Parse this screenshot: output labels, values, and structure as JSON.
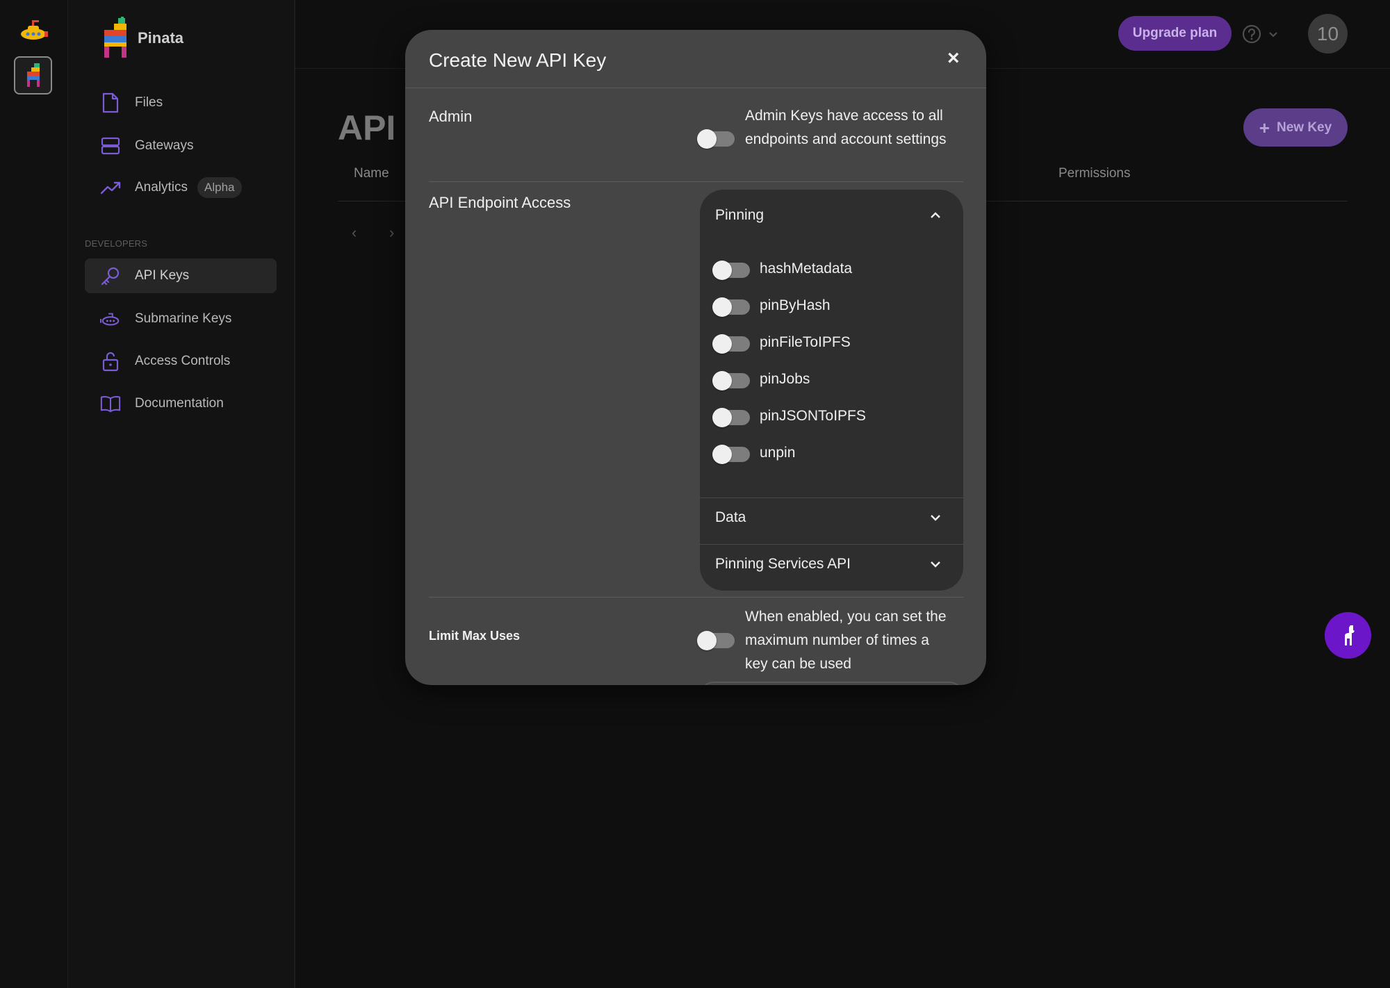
{
  "app": {
    "brand": "Pinata"
  },
  "sidebar": {
    "items": [
      {
        "label": "Files",
        "icon": "file-icon"
      },
      {
        "label": "Gateways",
        "icon": "server-icon"
      },
      {
        "label": "Analytics",
        "icon": "trend-icon",
        "badge": "Alpha"
      },
      {
        "label": "API Keys",
        "icon": "key-icon",
        "active": true
      },
      {
        "label": "Submarine Keys",
        "icon": "submarine-icon"
      },
      {
        "label": "Access Controls",
        "icon": "lock-icon"
      },
      {
        "label": "Documentation",
        "icon": "book-icon"
      }
    ],
    "section_developers": "DEVELOPERS"
  },
  "topbar": {
    "upgrade_label": "Upgrade plan",
    "avatar_text": "10"
  },
  "page": {
    "title": "API",
    "new_key_label": "New Key",
    "columns": [
      "Name",
      "Permissions"
    ],
    "pager_prev": "‹",
    "pager_next": "›"
  },
  "modal": {
    "title": "Create New API Key",
    "close": "×",
    "admin": {
      "label": "Admin",
      "description": "Admin Keys have access to all endpoints and account settings",
      "enabled": false
    },
    "endpoint_access": {
      "label": "API Endpoint Access",
      "groups": [
        {
          "name": "Pinning",
          "expanded": true,
          "endpoints": [
            {
              "name": "hashMetadata",
              "enabled": false
            },
            {
              "name": "pinByHash",
              "enabled": false
            },
            {
              "name": "pinFileToIPFS",
              "enabled": false
            },
            {
              "name": "pinJobs",
              "enabled": false
            },
            {
              "name": "pinJSONToIPFS",
              "enabled": false
            },
            {
              "name": "unpin",
              "enabled": false
            }
          ]
        },
        {
          "name": "Data",
          "expanded": false
        },
        {
          "name": "Pinning Services API",
          "expanded": false
        }
      ]
    },
    "limit_max_uses": {
      "label": "Limit Max Uses",
      "description": "When enabled, you can set the maximum number of times a key can be used",
      "enabled": false
    }
  },
  "colors": {
    "accent": "#6b17c9",
    "upgrade_bg": "#5b2d8e",
    "modal_bg": "#454545",
    "panel_bg": "#2e2e2e"
  }
}
